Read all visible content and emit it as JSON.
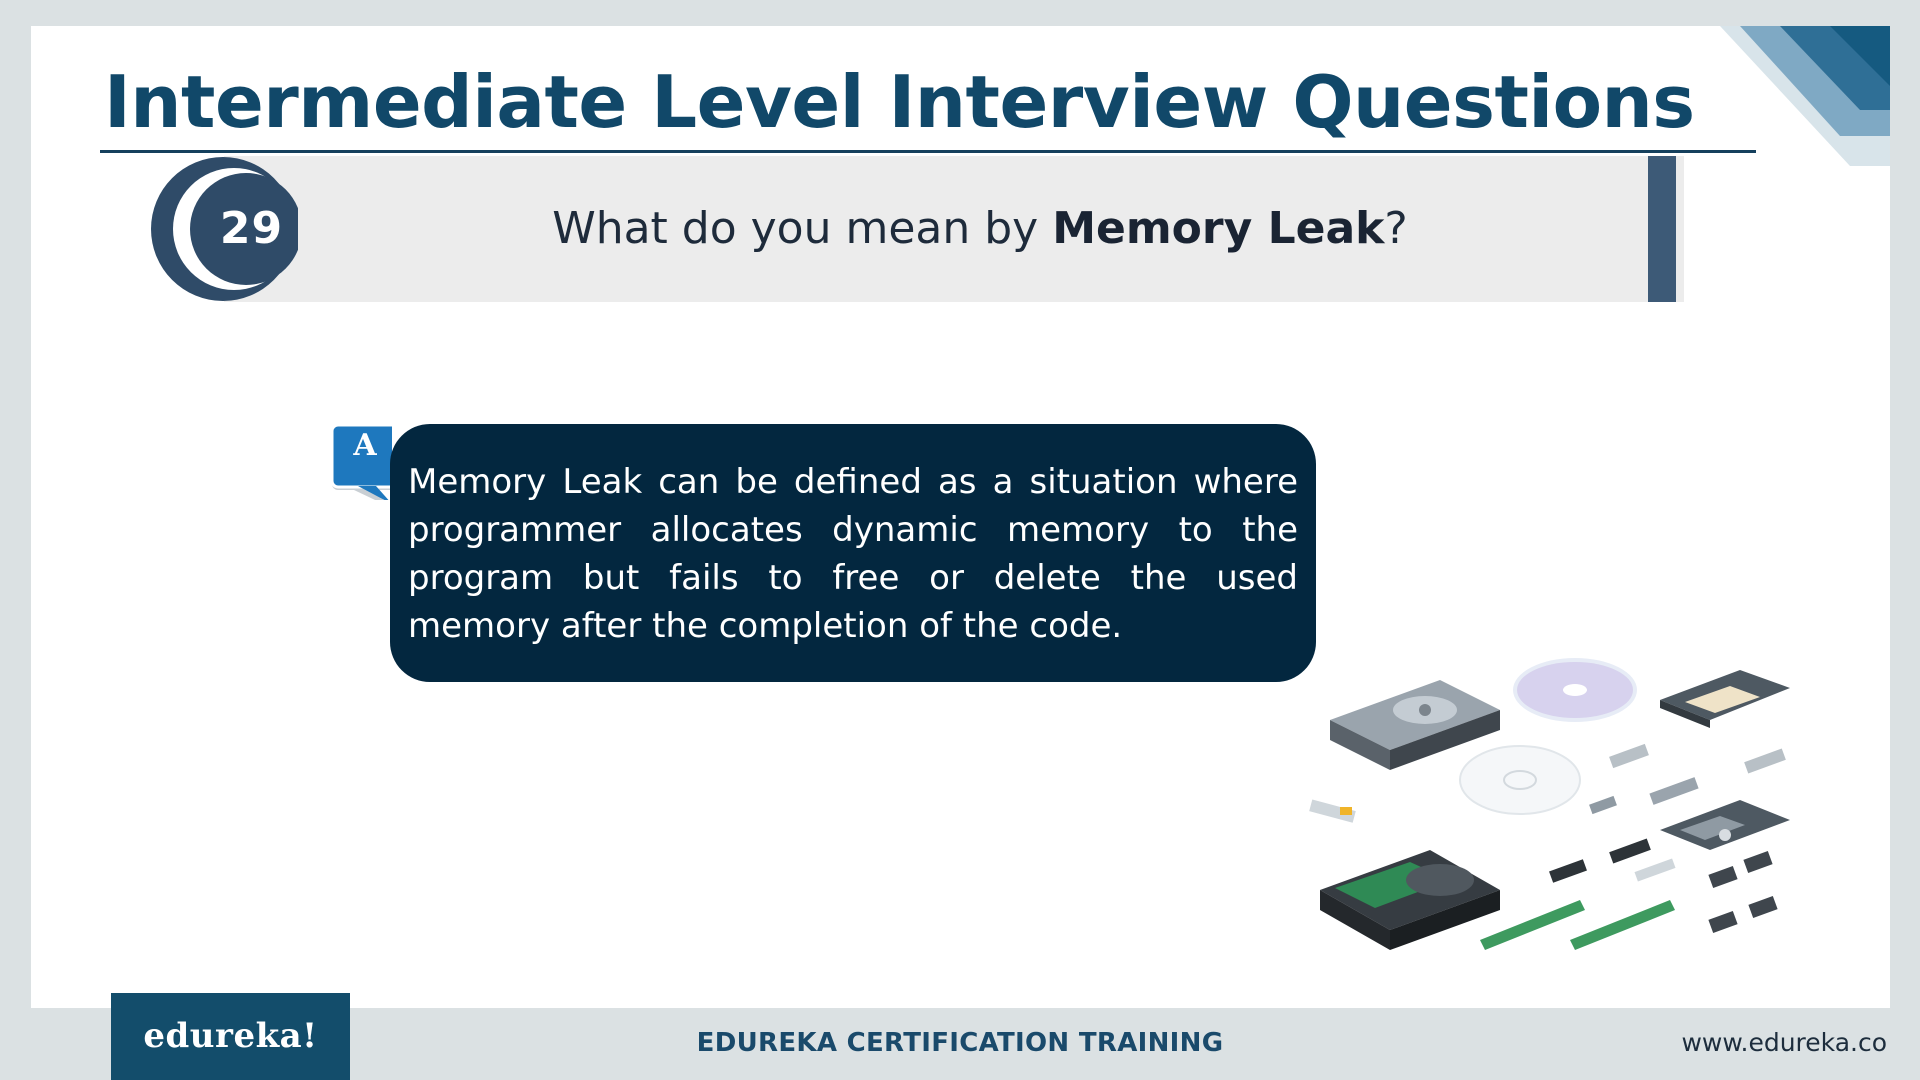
{
  "slide": {
    "title": "Intermediate Level Interview Questions",
    "question_number": "29",
    "question_prefix": "What do you mean by ",
    "question_bold": "Memory Leak",
    "question_suffix": "?",
    "answer_badge": "A",
    "answer_text": "Memory Leak can be defined as a situation where programmer allocates dynamic memory to the program but fails to free or delete the used memory after the completion of the code."
  },
  "footer": {
    "logo": "edureka!",
    "center_text": "EDUREKA CERTIFICATION TRAINING",
    "url": "www.edureka.co"
  },
  "colors": {
    "title": "#114869",
    "answer_bg": "#03273f",
    "badge": "#1e78be",
    "logo_bg": "#134d6b"
  },
  "icons": {
    "illustration": "storage-devices-illustration",
    "corner": "corner-decoration"
  }
}
